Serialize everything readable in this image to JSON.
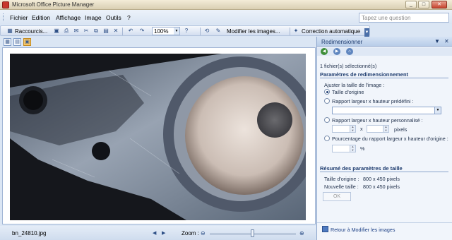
{
  "window": {
    "title": "Microsoft Office Picture Manager"
  },
  "menu": {
    "items": [
      "Fichier",
      "Edition",
      "Affichage",
      "Image",
      "Outils",
      "?"
    ]
  },
  "help": {
    "placeholder": "Tapez une question"
  },
  "toolbar": {
    "shortcuts_label": "Raccourcis...",
    "zoom_value": "100%",
    "edit_images_label": "Modifier les images...",
    "auto_correct_label": "Correction automatique"
  },
  "taskpane": {
    "title": "Redimensionner",
    "selected_count": "1 fichier(s) sélectionné(s)",
    "section_resize": "Paramètres de redimensionnement",
    "adjust_label": "Ajuster la taille de l'image :",
    "opt_original": "Taille d'origine",
    "opt_predefined": "Rapport largeur x hauteur prédéfini :",
    "opt_custom": "Rapport largeur x hauteur personnalisé :",
    "x_label": "x",
    "pixels_label": "pixels",
    "opt_percent": "Pourcentage du rapport largeur x hauteur d'origine :",
    "percent_sign": "%",
    "section_summary": "Résumé des paramètres de taille",
    "original_size_label": "Taille d'origine :",
    "original_size_value": "800 x 450 pixels",
    "new_size_label": "Nouvelle taille :",
    "new_size_value": "800 x 450 pixels",
    "ok_label": "OK",
    "back_link": "Retour à Modifier les images"
  },
  "status": {
    "filename": "bn_24810.jpg",
    "zoom_label": "Zoom :",
    "zoom_level": 0.5
  },
  "icons": {
    "app": "picture-manager-icon",
    "back": "back-arrow-icon",
    "forward": "forward-arrow-icon",
    "home": "home-icon"
  }
}
